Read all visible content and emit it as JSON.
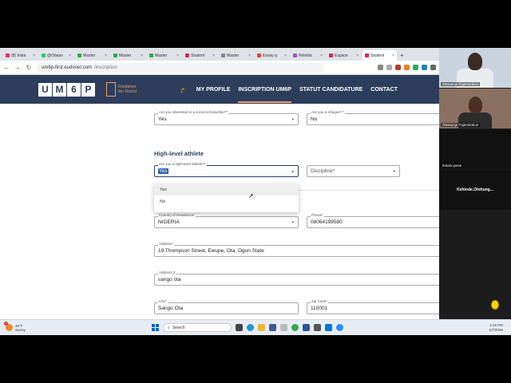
{
  "browser": {
    "tabs": [
      {
        "label": "(8) Insta",
        "color": "#e1306c"
      },
      {
        "label": "@Obaso",
        "color": "#25d366"
      },
      {
        "label": "Master",
        "color": "#34a853"
      },
      {
        "label": "Master",
        "color": "#34a853"
      },
      {
        "label": "Master",
        "color": "#34a853"
      },
      {
        "label": "Student",
        "color": "#e0245e"
      },
      {
        "label": "Master",
        "color": "#888888"
      },
      {
        "label": "Essay q",
        "color": "#ea4335"
      },
      {
        "label": "Réinitia",
        "color": "#9b59b6"
      },
      {
        "label": "Espace",
        "color": "#e0245e"
      },
      {
        "label": "Student",
        "color": "#e0245e"
      }
    ],
    "new_tab": "+",
    "url": "um6p-first.eudonet.com",
    "url_suffix": "/inscription",
    "back": "←",
    "forward": "→",
    "reload": "↻"
  },
  "site": {
    "logo_letters": [
      "U",
      "M",
      "6",
      "P"
    ],
    "foundation_line1": "Fondation",
    "foundation_line2": "Ibn Rochd",
    "menu": {
      "hat": "🎓",
      "my_profile": "MY PROFILE",
      "inscription": "INSCRIPTION UM6P",
      "statut": "STATUT CANDIDATURE",
      "contact": "CONTACT"
    }
  },
  "form": {
    "scholarship": {
      "label": "Are you interested in a social scholarship?*",
      "value": "Yes"
    },
    "refugee": {
      "label": "Are you a refugee? *",
      "value": "No"
    },
    "section_title": "High-level athlete",
    "athlete": {
      "label": "Are you a high-level athlete?*",
      "value": "Yes"
    },
    "discipline": {
      "placeholder": "Discipline*"
    },
    "dropdown_options": [
      "Yes",
      "No"
    ],
    "country": {
      "label": "Country of Residence*",
      "value": "NIGERIA"
    },
    "phone": {
      "label": "Phone*",
      "value": "08064199580"
    },
    "address": {
      "label": "Address*",
      "value": "19 Thompson Street, Ewupe, Ota, Ogun State"
    },
    "address2": {
      "label": "Address 2",
      "value": "sango ota"
    },
    "city": {
      "label": "City*",
      "value": "Sango Ota"
    },
    "zip": {
      "label": "Zip Code*",
      "value": "110001"
    },
    "arrow": "▾",
    "arrow_up": "▴"
  },
  "video_call": {
    "participants": [
      {
        "name": "Obasanjo Fajemirokun"
      },
      {
        "name": "Obasanjo Fajemirokun"
      },
      {
        "name": "Ibitola Ipese"
      },
      {
        "name": "Kehinde.Olohung..."
      }
    ]
  },
  "taskbar": {
    "temp": "46°F",
    "weather": "Sunny",
    "badge": "1",
    "search_placeholder": "Search",
    "time": "4:19 PM",
    "date": "1/7/2026"
  }
}
